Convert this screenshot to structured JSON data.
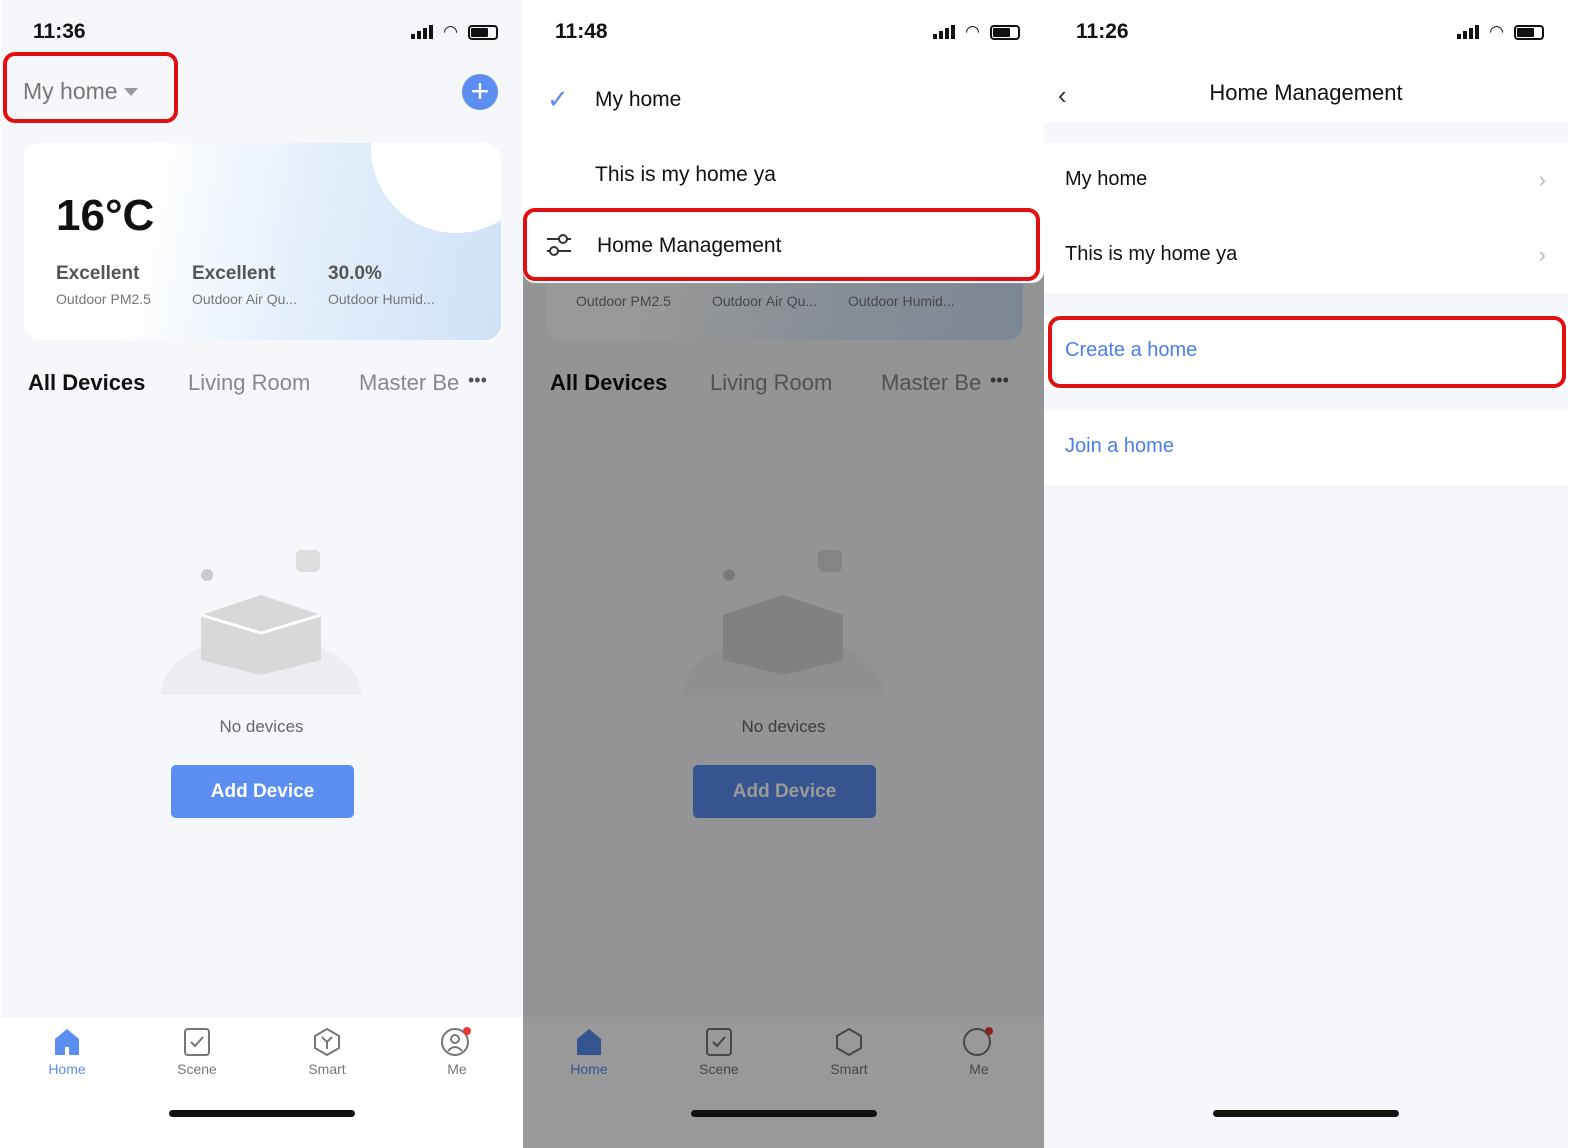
{
  "colors": {
    "accent": "#5b8ef0",
    "highlight": "#e01010"
  },
  "panel1": {
    "time": "11:36",
    "home_selector": "My home",
    "temperature": "16°C",
    "weather": [
      {
        "value": "Excellent",
        "label": "Outdoor PM2.5"
      },
      {
        "value": "Excellent",
        "label": "Outdoor Air Qu..."
      },
      {
        "value": "30.0%",
        "label": "Outdoor Humid..."
      }
    ],
    "tabs": [
      "All Devices",
      "Living Room",
      "Master Be"
    ],
    "more": "•••",
    "empty_text": "No devices",
    "add_device": "Add Device"
  },
  "tabbar": [
    {
      "label": "Home",
      "icon": "home-icon"
    },
    {
      "label": "Scene",
      "icon": "scene-icon"
    },
    {
      "label": "Smart",
      "icon": "smart-icon"
    },
    {
      "label": "Me",
      "icon": "me-icon"
    }
  ],
  "panel2": {
    "time": "11:48",
    "menu": [
      "My home",
      "This is my home ya",
      "Home Management"
    ],
    "weather_labels": [
      "Outdoor PM2.5",
      "Outdoor Air Qu...",
      "Outdoor Humid..."
    ]
  },
  "panel3": {
    "time": "11:26",
    "title": "Home Management",
    "homes": [
      "My home",
      "This is my home ya"
    ],
    "create": "Create a home",
    "join": "Join a home"
  }
}
